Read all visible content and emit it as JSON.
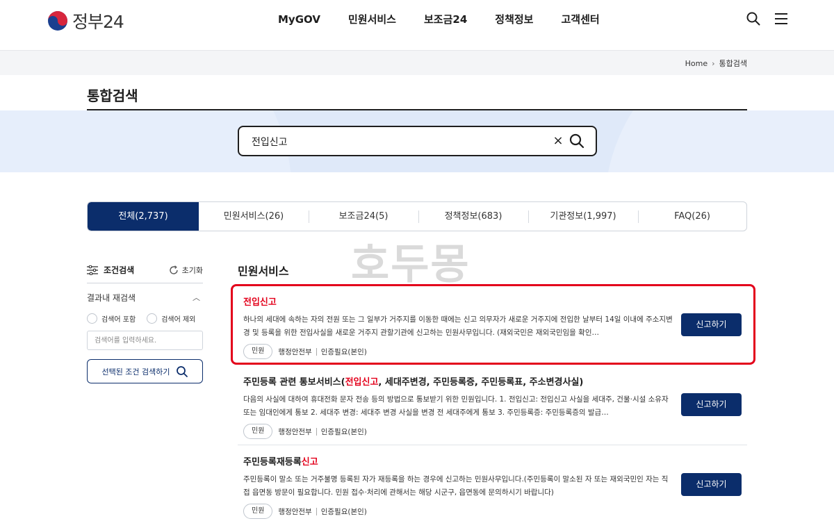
{
  "header": {
    "logo_text": "정부24",
    "nav": [
      "MyGOV",
      "민원서비스",
      "보조금24",
      "정책정보",
      "고객센터"
    ],
    "icons": [
      "search-icon",
      "menu-icon"
    ]
  },
  "breadcrumb": {
    "home": "Home",
    "current": "통합검색"
  },
  "page_title": "통합검색",
  "search": {
    "value": "전입신고",
    "clear_symbol": "×"
  },
  "tabs": [
    {
      "label": "전체(2,737)",
      "active": true
    },
    {
      "label": "민원서비스(26)",
      "active": false
    },
    {
      "label": "보조금24(5)",
      "active": false
    },
    {
      "label": "정책정보(683)",
      "active": false
    },
    {
      "label": "기관정보(1,997)",
      "active": false
    },
    {
      "label": "FAQ(26)",
      "active": false
    }
  ],
  "watermark": "호두몽",
  "filter": {
    "title": "조건검색",
    "reset": "초기화",
    "refine_title": "결과내 재검색",
    "include_label": "검색어 포함",
    "exclude_label": "검색어 제외",
    "input_placeholder": "검색어를 입력하세요.",
    "apply_label": "선택된 조건 검색하기"
  },
  "section_title": "민원서비스",
  "results": [
    {
      "title_parts": [
        {
          "text": "전입신고",
          "hit": true
        }
      ],
      "description": "하나의 세대에 속하는 자의 전원 또는 그 일부가 거주지를 이동한 때에는 신고 의무자가 새로운 거주지에 전입한 날부터 14일 이내에 주소지변경 및 등록을 위한 전입사실을 새로운 거주지 관할기관에 신고하는 민원사무입니다. (재외국민은 재외국민임을 확인…",
      "type": "민원",
      "agency": "행정안전부",
      "auth": "인증필요(본인)",
      "button": "신고하기"
    },
    {
      "title_parts": [
        {
          "text": "주민등록 관련 통보서비스(",
          "hit": false
        },
        {
          "text": "전입신고",
          "hit": true
        },
        {
          "text": ", 세대주변경, 주민등록증, 주민등록표, 주소변경사실)",
          "hit": false
        }
      ],
      "description": "다음의 사실에 대하여 휴대전화 문자 전송 등의 방법으로 통보받기 위한 민원입니다. 1. 전입신고: 전입신고 사실을 세대주, 건물·시설 소유자 또는 임대인에게 통보 2. 세대주 변경: 세대주 변경 사실을 변경 전 세대주에게 통보 3. 주민등록증: 주민등록증의 발급…",
      "type": "민원",
      "agency": "행정안전부",
      "auth": "인증필요(본인)",
      "button": "신고하기"
    },
    {
      "title_parts": [
        {
          "text": "주민등록재등록",
          "hit": false
        },
        {
          "text": "신고",
          "hit": true
        }
      ],
      "description": "주민등록이 말소 또는 거주불명 등록된 자가 재등록을 하는 경우에 신고하는 민원사무입니다.(주민등록이 말소된 자 또는 재외국민인 자는 직접 읍면동 방문이 필요합니다. 민원 접수·처리에 관해서는 해당 시군구, 읍면동에 문의하시기 바랍니다)",
      "type": "민원",
      "agency": "행정안전부",
      "auth": "인증필요(본인)",
      "button": "신고하기"
    }
  ],
  "colors": {
    "primary": "#0b2d6b",
    "highlight": "#e3001b",
    "band": "#dfe9f9"
  }
}
